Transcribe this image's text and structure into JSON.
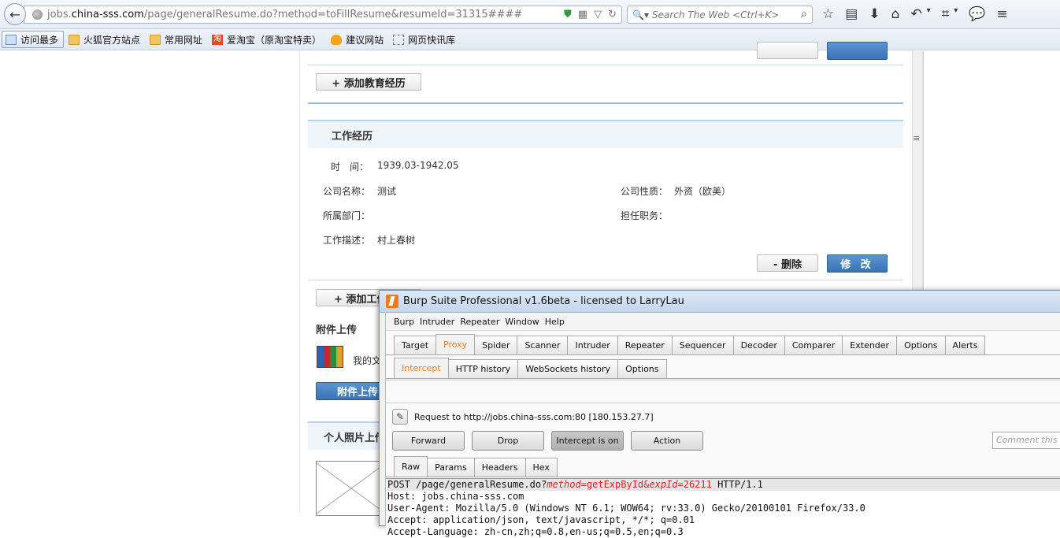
{
  "browser": {
    "url_host": "jobs.china-sss.com",
    "url_prefix": "jobs.",
    "url_host_main": "china-sss.com",
    "url_path": "/page/generalResume.do?method=toFillResume&resumeId=31315####",
    "search_placeholder": "Search The Web <Ctrl+K>",
    "bookmarks": [
      {
        "label": "访问最多",
        "icon": "most-visited-icon"
      },
      {
        "label": "火狐官方站点",
        "icon": "folder-icon"
      },
      {
        "label": "常用网址",
        "icon": "folder-icon"
      },
      {
        "label": "爱淘宝（原淘宝特卖）",
        "icon": "taobao-icon",
        "glyph": "淘"
      },
      {
        "label": "建议网站",
        "icon": "bulb-icon"
      },
      {
        "label": "网页快讯库",
        "icon": "web-slice-icon"
      }
    ]
  },
  "resume": {
    "add_education_label": "+ 添加教育经历",
    "work_section_title": "工作经历",
    "work": {
      "time_label": "时　间：",
      "time_value": "1939.03-1942.05",
      "company_label": "公司名称：",
      "company_value": "测试",
      "nature_label": "公司性质：",
      "nature_value": "外资（欧美）",
      "dept_label": "所属部门：",
      "dept_value": "",
      "position_label": "担任职务：",
      "position_value": "",
      "desc_label": "工作描述：",
      "desc_value": "村上春树"
    },
    "delete_label": "- 删除",
    "edit_label": "修 改",
    "add_work_label": "+ 添加工作经历",
    "attachment_title": "附件上传",
    "attachment_text": "我的文",
    "attachment_btn": "附件上传",
    "photo_title": "个人照片上传"
  },
  "burp": {
    "title": "Burp Suite Professional v1.6beta - licensed to LarryLau",
    "menu": [
      "Burp",
      "Intruder",
      "Repeater",
      "Window",
      "Help"
    ],
    "tabs": [
      "Target",
      "Proxy",
      "Spider",
      "Scanner",
      "Intruder",
      "Repeater",
      "Sequencer",
      "Decoder",
      "Comparer",
      "Extender",
      "Options",
      "Alerts"
    ],
    "selected_tab": "Proxy",
    "subtabs": [
      "Intercept",
      "HTTP history",
      "WebSockets history",
      "Options"
    ],
    "selected_subtab": "Intercept",
    "request_line": "Request to http://jobs.china-sss.com:80  [180.153.27.7]",
    "forward_label": "Forward",
    "drop_label": "Drop",
    "intercept_label": "Intercept is on",
    "action_label": "Action",
    "comment_placeholder": "Comment this item",
    "view_tabs": [
      "Raw",
      "Params",
      "Headers",
      "Hex"
    ],
    "selected_view": "Raw",
    "raw": {
      "l1_a": "POST /page/generalResume.do?",
      "l1_k1": "method",
      "l1_eq1": "=",
      "l1_v1": "getExpById",
      "l1_amp": "&",
      "l1_k2": "expId",
      "l1_eq2": "=",
      "l1_v2": "26211",
      "l1_b": " HTTP/1.1",
      "l2": "Host: jobs.china-sss.com",
      "l3": "User-Agent: Mozilla/5.0 (Windows NT 6.1; WOW64; rv:33.0) Gecko/20100101 Firefox/33.0",
      "l4": "Accept: application/json, text/javascript, */*; q=0.01",
      "l5": "Accept-Language: zh-cn,zh;q=0.8,en-us;q=0.5,en;q=0.3"
    }
  }
}
